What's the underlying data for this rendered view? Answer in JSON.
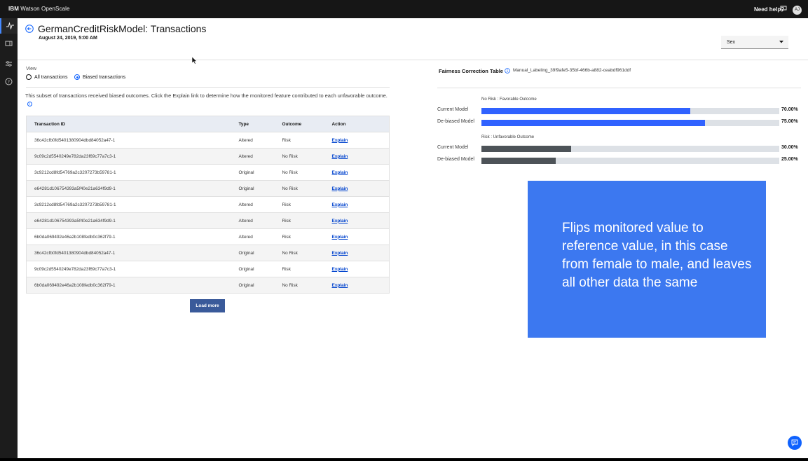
{
  "app": {
    "brand_bold": "IBM",
    "brand_name": "Watson OpenScale",
    "help_label": "Need help?",
    "avatar_initials": "AJ"
  },
  "page": {
    "title": "GermanCreditRiskModel: Transactions",
    "date": "August 24, 2019, 5:00 AM",
    "dropdown_value": "Sex"
  },
  "view": {
    "label": "View",
    "option_all": "All transactions",
    "option_biased": "Biased transactions",
    "selected": "Biased transactions"
  },
  "description": "This subset of transactions received biased outcomes. Click the Explain link to determine how the monitored feature contributed to each unfavorable outcome.",
  "table": {
    "headers": [
      "Transaction ID",
      "Type",
      "Outcome",
      "Action"
    ],
    "rows": [
      {
        "id": "36c42cfb0fd5401380904dbd84052a47-1",
        "type": "Altered",
        "outcome": "Risk",
        "action": "Explain"
      },
      {
        "id": "9c09c2d5540249e782da23f69c77a7c3-1",
        "type": "Altered",
        "outcome": "No Risk",
        "action": "Explain"
      },
      {
        "id": "3c9212cd8fd54769a2c3207273b59781-1",
        "type": "Original",
        "outcome": "No Risk",
        "action": "Explain"
      },
      {
        "id": "e64281d106754393a5f40e21a634f9d9-1",
        "type": "Original",
        "outcome": "No Risk",
        "action": "Explain"
      },
      {
        "id": "3c9212cd8fd54769a2c3207273b59781-1",
        "type": "Altered",
        "outcome": "Risk",
        "action": "Explain"
      },
      {
        "id": "e64281d106754393a5f40e21a634f9d9-1",
        "type": "Altered",
        "outcome": "Risk",
        "action": "Explain"
      },
      {
        "id": "6b0da069492e46a2b108fedb0c362f79-1",
        "type": "Altered",
        "outcome": "Risk",
        "action": "Explain"
      },
      {
        "id": "36c42cfb0fd5401380904dbd84052a47-1",
        "type": "Original",
        "outcome": "No Risk",
        "action": "Explain"
      },
      {
        "id": "9c09c2d5540249e782da23f69c77a7c3-1",
        "type": "Original",
        "outcome": "Risk",
        "action": "Explain"
      },
      {
        "id": "6b0da069492e46a2b108fedb0c362f79-1",
        "type": "Original",
        "outcome": "No Risk",
        "action": "Explain"
      }
    ],
    "load_more": "Load more"
  },
  "fairness": {
    "title": "Fairness Correction Table",
    "table_id": "Manual_Labeling_39f9afe5-35bf-466b-a882-ceabdf961ddf",
    "groups": [
      {
        "label": "No Risk : Favorable Outcome",
        "color": "#3062ff",
        "bars": [
          {
            "name": "Current Model",
            "value": 70,
            "display": "70.00%"
          },
          {
            "name": "De-biased Model",
            "value": 75,
            "display": "75.00%"
          }
        ]
      },
      {
        "label": "Risk : Unfavorable Outcome",
        "color": "#4d5358",
        "bars": [
          {
            "name": "Current Model",
            "value": 30,
            "display": "30.00%"
          },
          {
            "name": "De-biased Model",
            "value": 25,
            "display": "25.00%"
          }
        ]
      }
    ]
  },
  "overlay_text": "Flips monitored value to reference value, in this case from female to male, and leaves all other data the same",
  "colors": {
    "accent": "#0f62fe",
    "overlay": "#3c78f0",
    "topbar": "#161616"
  }
}
